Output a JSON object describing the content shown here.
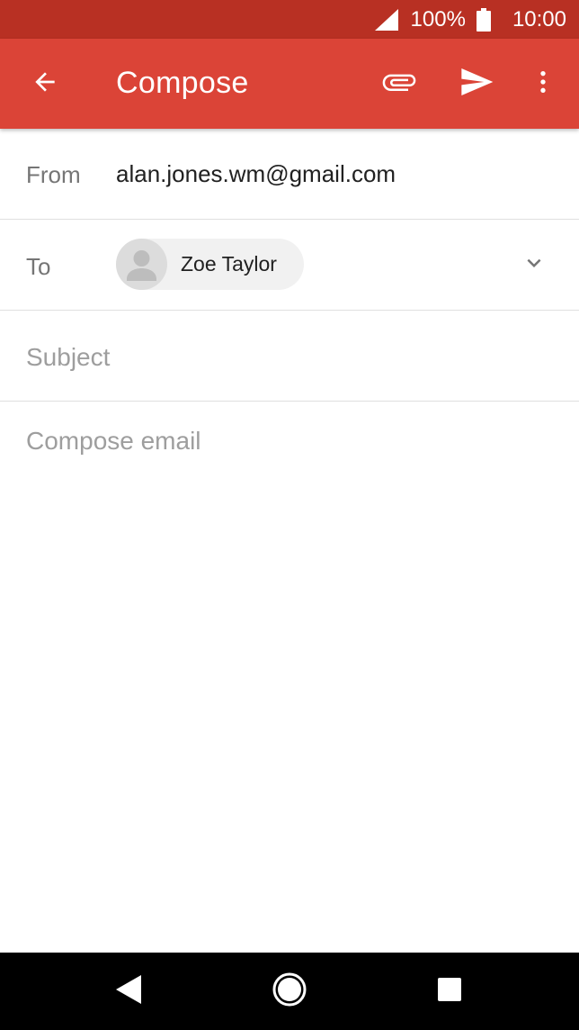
{
  "status_bar": {
    "battery_percent": "100%",
    "time": "10:00",
    "icons": [
      "signal-icon",
      "battery-icon"
    ]
  },
  "app_bar": {
    "title": "Compose",
    "icons": [
      "back-arrow-icon",
      "attach-icon",
      "send-icon",
      "more-vert-icon"
    ]
  },
  "from": {
    "label": "From",
    "value": "alan.jones.wm@gmail.com"
  },
  "to": {
    "label": "To",
    "recipients": [
      {
        "name": "Zoe Taylor",
        "icon": "person-avatar-icon"
      }
    ],
    "expand_icon": "chevron-down-icon"
  },
  "subject": {
    "value": "",
    "placeholder": "Subject"
  },
  "body": {
    "value": "",
    "placeholder": "Compose email"
  },
  "nav_bar": {
    "icons": [
      "nav-back-icon",
      "nav-home-icon",
      "nav-recents-icon"
    ]
  },
  "colors": {
    "status_bar": "#b83023",
    "app_bar": "#db4437",
    "divider": "#e0e0e0",
    "chip_background": "#f1f1f1",
    "placeholder_text": "#9e9e9e"
  }
}
